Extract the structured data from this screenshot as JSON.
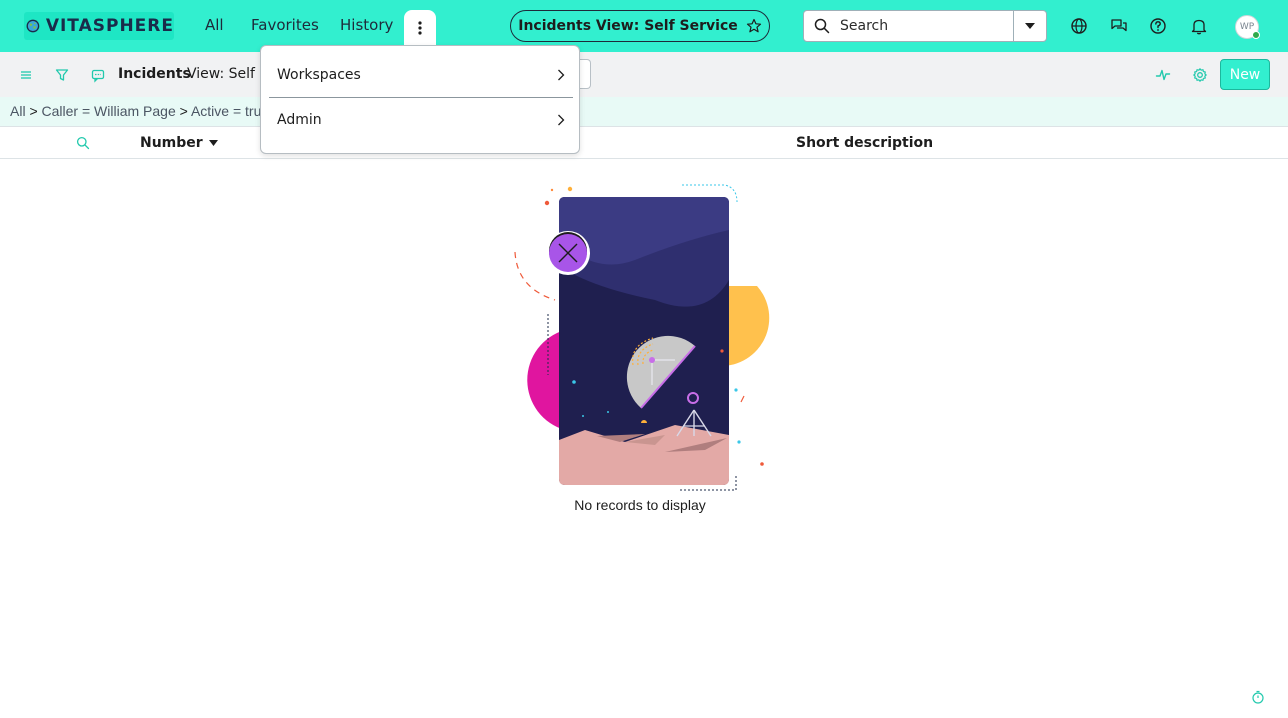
{
  "topbar": {
    "logo_text": "VITASPHERE",
    "nav": [
      {
        "label": "All"
      },
      {
        "label": "Favorites"
      },
      {
        "label": "History"
      }
    ],
    "context_pill": "Incidents View: Self Service",
    "search": {
      "placeholder": "Search"
    },
    "icons": [
      "globe-icon",
      "chat-icon",
      "help-icon",
      "bell-icon"
    ],
    "avatar_initials": "WP",
    "accent_color": "#32efcf"
  },
  "list_header": {
    "title": "Incidents",
    "view_label": "View: Self Service",
    "new_button": "New"
  },
  "breadcrumb": {
    "parts": [
      "All",
      "Caller = William Page",
      "Active = true"
    ],
    "separator": ">"
  },
  "columns": {
    "number": "Number",
    "short_description": "Short description"
  },
  "empty_state": {
    "message": "No records to display"
  },
  "menu": {
    "items": [
      {
        "label": "Workspaces"
      },
      {
        "label": "Admin"
      }
    ]
  }
}
